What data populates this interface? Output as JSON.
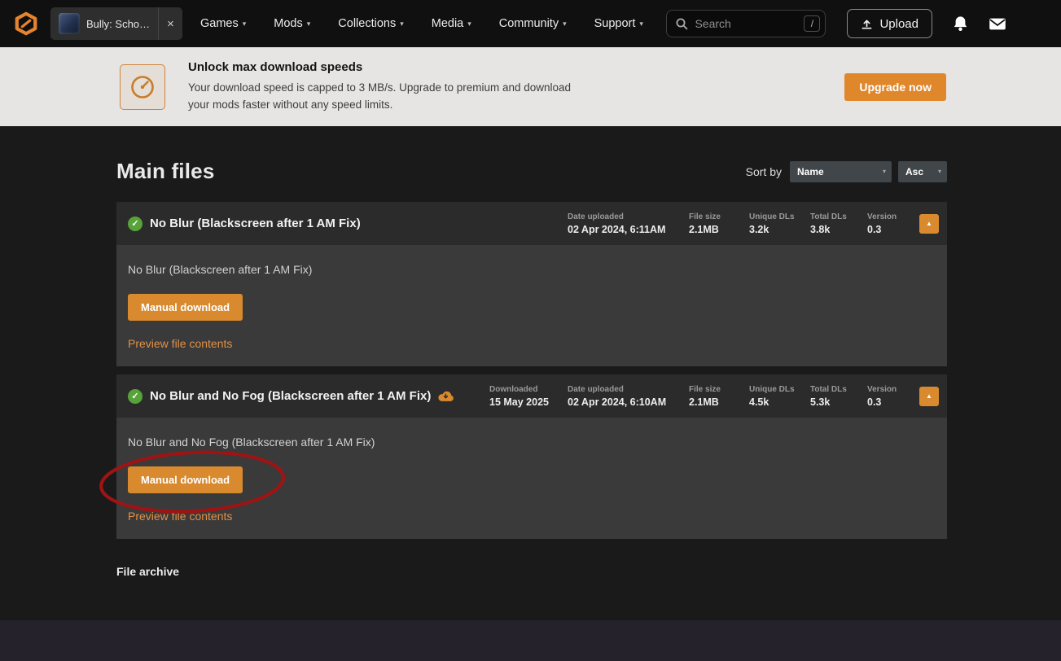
{
  "icons": {
    "chevron_down": "▾",
    "caret_up": "▲",
    "check": "✓",
    "close": "×"
  },
  "navbar": {
    "tab": {
      "label": "Bully: Scho…"
    },
    "items": [
      {
        "label": "Games"
      },
      {
        "label": "Mods"
      },
      {
        "label": "Collections"
      },
      {
        "label": "Media"
      },
      {
        "label": "Community"
      },
      {
        "label": "Support"
      }
    ],
    "search": {
      "placeholder": "Search",
      "shortcut": "/"
    },
    "upload_label": "Upload"
  },
  "banner": {
    "title": "Unlock max download speeds",
    "description_line1": "Your download speed is capped to 3 MB/s. Upgrade to premium and download",
    "description_line2": "your mods faster without any speed limits.",
    "cta_label": "Upgrade now"
  },
  "main": {
    "title": "Main files",
    "sort": {
      "label": "Sort by",
      "field": "Name",
      "direction": "Asc"
    },
    "files": [
      {
        "name": "No Blur (Blackscreen after 1 AM Fix)",
        "stats": [
          {
            "label": "Date uploaded",
            "value": "02 Apr 2024, 6:11AM"
          },
          {
            "label": "File size",
            "value": "2.1MB"
          },
          {
            "label": "Unique DLs",
            "value": "3.2k"
          },
          {
            "label": "Total DLs",
            "value": "3.8k"
          },
          {
            "label": "Version",
            "value": "0.3"
          }
        ],
        "description": "No Blur (Blackscreen after 1 AM Fix)",
        "download_label": "Manual download",
        "preview_label": "Preview file contents"
      },
      {
        "name": "No Blur and No Fog (Blackscreen after 1 AM Fix)",
        "stats": [
          {
            "label": "Downloaded",
            "value": "15 May 2025"
          },
          {
            "label": "Date uploaded",
            "value": "02 Apr 2024, 6:10AM"
          },
          {
            "label": "File size",
            "value": "2.1MB"
          },
          {
            "label": "Unique DLs",
            "value": "4.5k"
          },
          {
            "label": "Total DLs",
            "value": "5.3k"
          },
          {
            "label": "Version",
            "value": "0.3"
          }
        ],
        "description": "No Blur and No Fog (Blackscreen after 1 AM Fix)",
        "download_label": "Manual download",
        "preview_label": "Preview file contents"
      }
    ],
    "archive_title": "File archive"
  }
}
